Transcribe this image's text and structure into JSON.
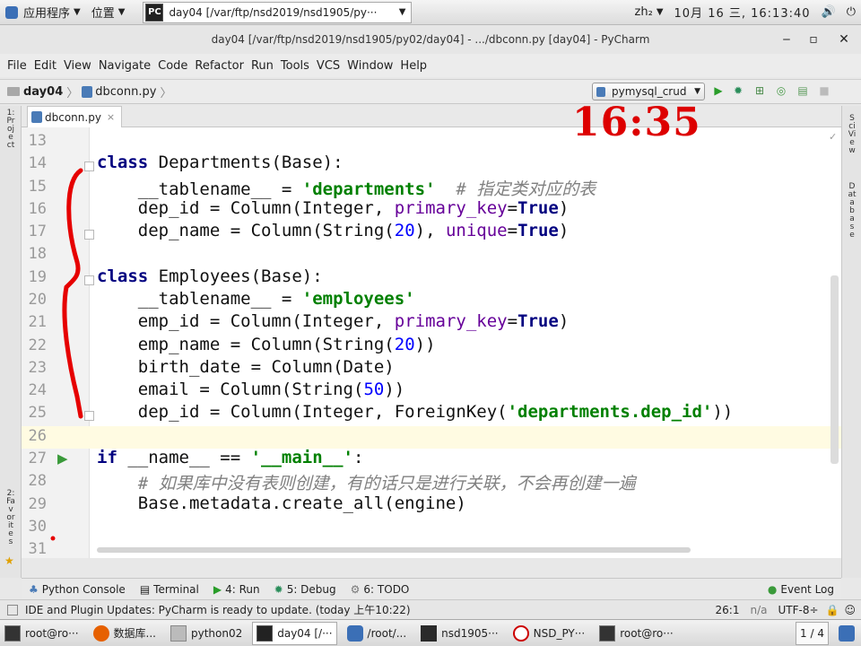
{
  "topbar": {
    "apps_menu": "应用程序",
    "places_menu": "位置",
    "task_title": "day04 [/var/ftp/nsd2019/nsd1905/py···",
    "input_method": "zh₂",
    "datetime": "10月 16 三, 16:13:40"
  },
  "window": {
    "title": "day04 [/var/ftp/nsd2019/nsd1905/py02/day04] - .../dbconn.py [day04] - PyCharm"
  },
  "menu": [
    "File",
    "Edit",
    "View",
    "Navigate",
    "Code",
    "Refactor",
    "Run",
    "Tools",
    "VCS",
    "Window",
    "Help"
  ],
  "nav": {
    "project": "day04",
    "file": "dbconn.py",
    "run_config": "pymysql_crud"
  },
  "editor_tab": "dbconn.py",
  "side_labels": {
    "left_top": "1:Project",
    "left_bottom": "2:Favorites",
    "right_top": "SciView",
    "right_bottom": "Database"
  },
  "overlay_clock": "16:35",
  "line_numbers": [
    "13",
    "14",
    "15",
    "16",
    "17",
    "18",
    "19",
    "20",
    "21",
    "22",
    "23",
    "24",
    "25",
    "26",
    "27",
    "28",
    "29",
    "30",
    "31"
  ],
  "code": {
    "l14": [
      "class",
      "Departments(Base):"
    ],
    "l15": [
      "__tablename__ = ",
      "'departments'",
      "  # 指定类对应的表"
    ],
    "l16": [
      "dep_id = Column(Integer, ",
      "primary_key",
      "=",
      "True",
      ")"
    ],
    "l17": [
      "dep_name = Column(String(",
      "20",
      "), ",
      "unique",
      "=",
      "True",
      ")"
    ],
    "l19": [
      "class",
      "Employees(Base):"
    ],
    "l20": [
      "__tablename__ = ",
      "'employees'"
    ],
    "l21": [
      "emp_id = Column(Integer, ",
      "primary_key",
      "=",
      "True",
      ")"
    ],
    "l22": [
      "emp_name = Column(String(",
      "20",
      "))"
    ],
    "l23": [
      "birth_date = Column(Date)"
    ],
    "l24": [
      "email = Column(String(",
      "50",
      "))"
    ],
    "l25": [
      "dep_id = Column(Integer, ForeignKey(",
      "'departments.dep_id'",
      "))"
    ],
    "l27": [
      "if",
      " __name__ == ",
      "'__main__'",
      ":"
    ],
    "l28": [
      "# 如果库中没有表则创建，有的话只是进行关联，不会再创建一遍"
    ],
    "l29": [
      "Base.metadata.create_all(engine)"
    ]
  },
  "toolwindows": [
    {
      "icon": "python-console-icon",
      "label": "Python Console"
    },
    {
      "icon": "terminal-icon",
      "label": "Terminal"
    },
    {
      "icon": "run-icon",
      "label": "4: Run"
    },
    {
      "icon": "debug-icon",
      "label": "5: Debug"
    },
    {
      "icon": "todo-icon",
      "label": "6: TODO"
    }
  ],
  "event_log": "Event Log",
  "status": {
    "message": "IDE and Plugin Updates: PyCharm is ready to update. (today 上午10:22)",
    "position": "26:1",
    "na": "n/a",
    "encoding": "UTF-8÷"
  },
  "taskbar": {
    "items": [
      "root@ro···",
      "数据库...",
      "python02",
      "day04 [/···",
      "/root/...",
      "nsd1905···",
      "NSD_PY···",
      "root@ro···"
    ],
    "pager": "1 / 4"
  }
}
